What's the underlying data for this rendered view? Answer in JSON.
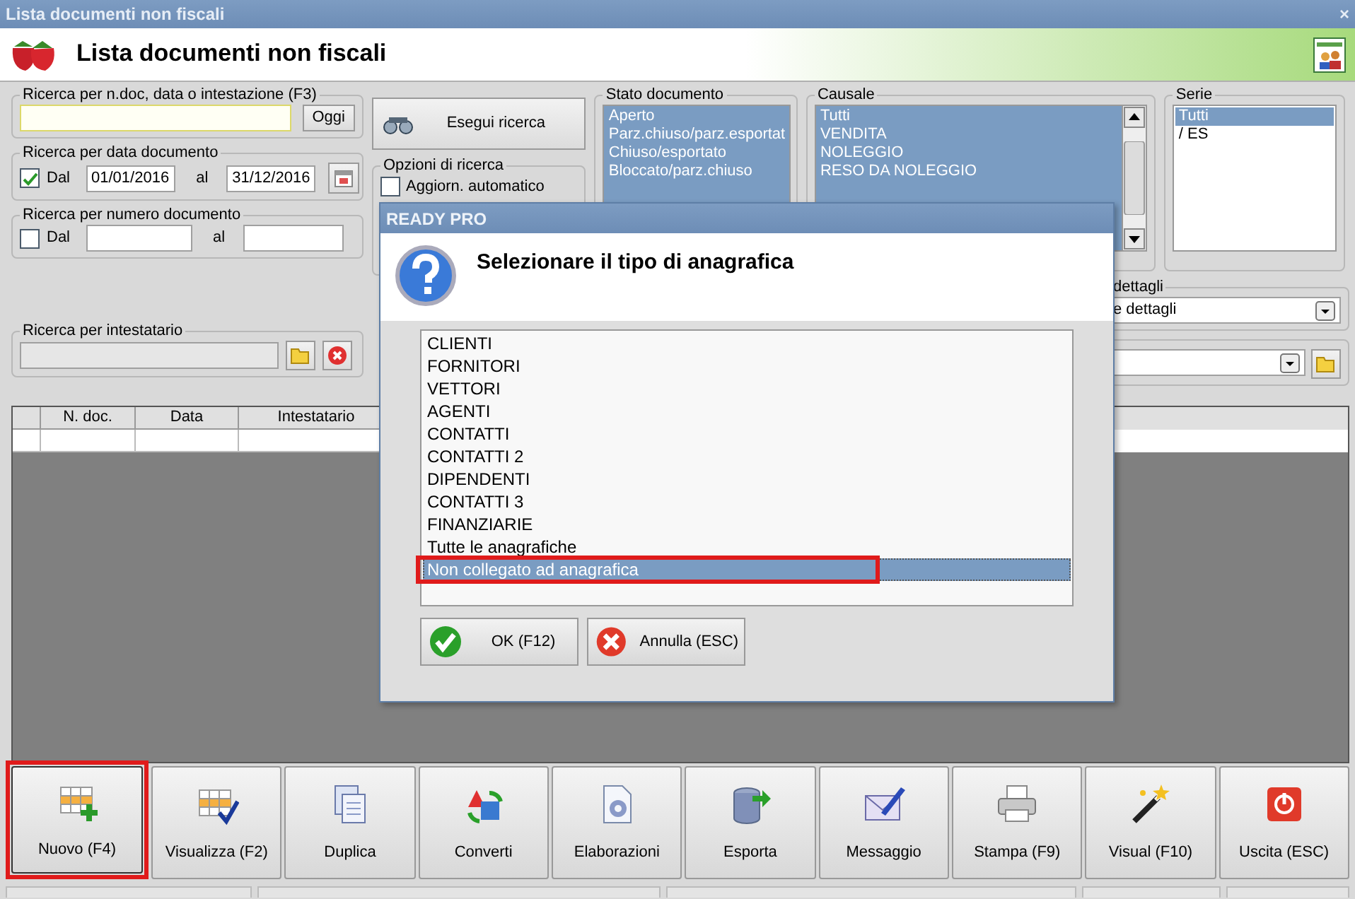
{
  "window": {
    "title": "Lista documenti non fiscali",
    "close": "×"
  },
  "header": {
    "title": "Lista documenti non fiscali"
  },
  "quick_search": {
    "legend": "Ricerca per n.doc, data o intestazione (F3)",
    "button": "Oggi"
  },
  "date_search": {
    "legend": "Ricerca per data documento",
    "checked": true,
    "from_label": "Dal",
    "from": "01/01/2016",
    "to_label": "al",
    "to": "31/12/2016"
  },
  "number_search": {
    "legend": "Ricerca per numero documento",
    "checked": false,
    "from_label": "Dal",
    "to_label": "al"
  },
  "holder_search": {
    "legend": "Ricerca per intestatario"
  },
  "search_button": {
    "label": "Esegui ricerca"
  },
  "search_options": {
    "legend": "Opzioni di ricerca",
    "options": [
      {
        "label": "Aggiorn. automatico",
        "checked": false
      }
    ]
  },
  "status_list": {
    "legend": "Stato documento",
    "items": [
      {
        "label": "Aperto",
        "selected": true
      },
      {
        "label": "Parz.chiuso/parz.esportat",
        "selected": true
      },
      {
        "label": "Chiuso/esportato",
        "selected": true
      },
      {
        "label": "Bloccato/parz.chiuso",
        "selected": true
      }
    ]
  },
  "reason_list": {
    "legend": "Causale",
    "items": [
      {
        "label": "Tutti",
        "selected": true
      },
      {
        "label": "VENDITA",
        "selected": true
      },
      {
        "label": "NOLEGGIO",
        "selected": true
      },
      {
        "label": "RESO DA NOLEGGIO",
        "selected": true
      }
    ]
  },
  "series_list": {
    "legend": "Serie",
    "items": [
      {
        "label": "Tutti",
        "selected": true
      },
      {
        "label": "/ ES",
        "selected": false
      }
    ]
  },
  "details": {
    "legend": "dettagli",
    "value": "e dettagli"
  },
  "table": {
    "columns": [
      "N. doc.",
      "Data",
      "Intestatario"
    ]
  },
  "toolbar": [
    {
      "label": "Nuovo (F4)",
      "kind": "new",
      "highlighted": true
    },
    {
      "label": "Visualizza (F2)",
      "kind": "view",
      "highlighted": false
    },
    {
      "label": "Duplica",
      "kind": "duplicate",
      "highlighted": false
    },
    {
      "label": "Converti",
      "kind": "convert",
      "highlighted": false
    },
    {
      "label": "Elaborazioni",
      "kind": "process",
      "highlighted": false
    },
    {
      "label": "Esporta",
      "kind": "export",
      "highlighted": false
    },
    {
      "label": "Messaggio",
      "kind": "message",
      "highlighted": false
    },
    {
      "label": "Stampa (F9)",
      "kind": "print",
      "highlighted": false
    },
    {
      "label": "Visual (F10)",
      "kind": "visual",
      "highlighted": false
    },
    {
      "label": "Uscita (ESC)",
      "kind": "exit",
      "highlighted": false
    }
  ],
  "dialog": {
    "title": "READY PRO",
    "message": "Selezionare il tipo di anagrafica",
    "items": [
      {
        "label": "CLIENTI",
        "selected": false,
        "highlighted": false
      },
      {
        "label": "FORNITORI",
        "selected": false,
        "highlighted": false
      },
      {
        "label": "VETTORI",
        "selected": false,
        "highlighted": false
      },
      {
        "label": "AGENTI",
        "selected": false,
        "highlighted": false
      },
      {
        "label": "CONTATTI",
        "selected": false,
        "highlighted": false
      },
      {
        "label": "CONTATTI 2",
        "selected": false,
        "highlighted": false
      },
      {
        "label": "DIPENDENTI",
        "selected": false,
        "highlighted": false
      },
      {
        "label": "CONTATTI 3",
        "selected": false,
        "highlighted": false
      },
      {
        "label": "FINANZIARIE",
        "selected": false,
        "highlighted": false
      },
      {
        "label": "Tutte le anagrafiche",
        "selected": false,
        "highlighted": false
      },
      {
        "label": "Non collegato ad anagrafica",
        "selected": true,
        "highlighted": true
      }
    ],
    "buttons": [
      {
        "label": "OK (F12)",
        "kind": "ok"
      },
      {
        "label": "Annulla (ESC)",
        "kind": "cancel"
      }
    ]
  }
}
